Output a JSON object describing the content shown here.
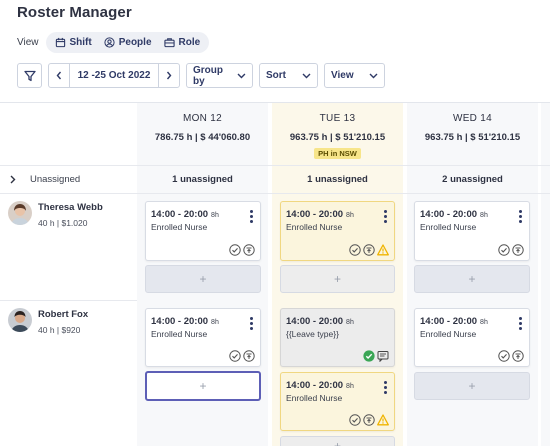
{
  "app": {
    "title": "Roster Manager"
  },
  "view": {
    "label": "View",
    "options": [
      {
        "label": "Shift",
        "icon": "calendar-icon"
      },
      {
        "label": "People",
        "icon": "people-icon"
      },
      {
        "label": "Role",
        "icon": "briefcase-icon"
      }
    ]
  },
  "toolbar": {
    "date_range": "12 -25 Oct 2022",
    "group_by": "Group by",
    "sort": "Sort",
    "view": "View"
  },
  "days": [
    {
      "name": "MON 12",
      "stats": "786.75 h | $ 44'060.80",
      "badge": ""
    },
    {
      "name": "TUE 13",
      "stats": "963.75 h | $ 51'210.15",
      "badge": "PH in NSW"
    },
    {
      "name": "WED 14",
      "stats": "963.75 h | $ 51'210.15",
      "badge": ""
    }
  ],
  "unassigned": {
    "label": "Unassigned",
    "counts": [
      "1  unassigned",
      "1  unassigned",
      "2  unassigned"
    ]
  },
  "people": [
    {
      "name": "Theresa Webb",
      "meta": "40 h | $1.020"
    },
    {
      "name": "Robert Fox",
      "meta": "40 h | $920"
    }
  ],
  "shifts": {
    "theresa_mon": {
      "time": "14:00 - 20:00",
      "hours": "8h",
      "role": "Enrolled Nurse"
    },
    "theresa_tue": {
      "time": "14:00 - 20:00",
      "hours": "8h",
      "role": "Enrolled Nurse"
    },
    "theresa_wed": {
      "time": "14:00 - 20:00",
      "hours": "8h",
      "role": "Enrolled Nurse"
    },
    "robert_mon": {
      "time": "14:00 - 20:00",
      "hours": "8h",
      "role": "Enrolled Nurse"
    },
    "robert_tue_leave": {
      "time": "14:00 - 20:00",
      "hours": "8h",
      "role": "{{Leave type}}"
    },
    "robert_tue": {
      "time": "14:00 - 20:00",
      "hours": "8h",
      "role": "Enrolled Nurse"
    },
    "robert_wed": {
      "time": "14:00 - 20:00",
      "hours": "8h",
      "role": "Enrolled Nurse"
    }
  },
  "add_label": "+",
  "colors": {
    "accent": "#2f3a66",
    "holiday_bg": "#fcf8ea",
    "badge": "#f7e58a",
    "warning": "#f0b400",
    "approved": "#3aa655"
  }
}
